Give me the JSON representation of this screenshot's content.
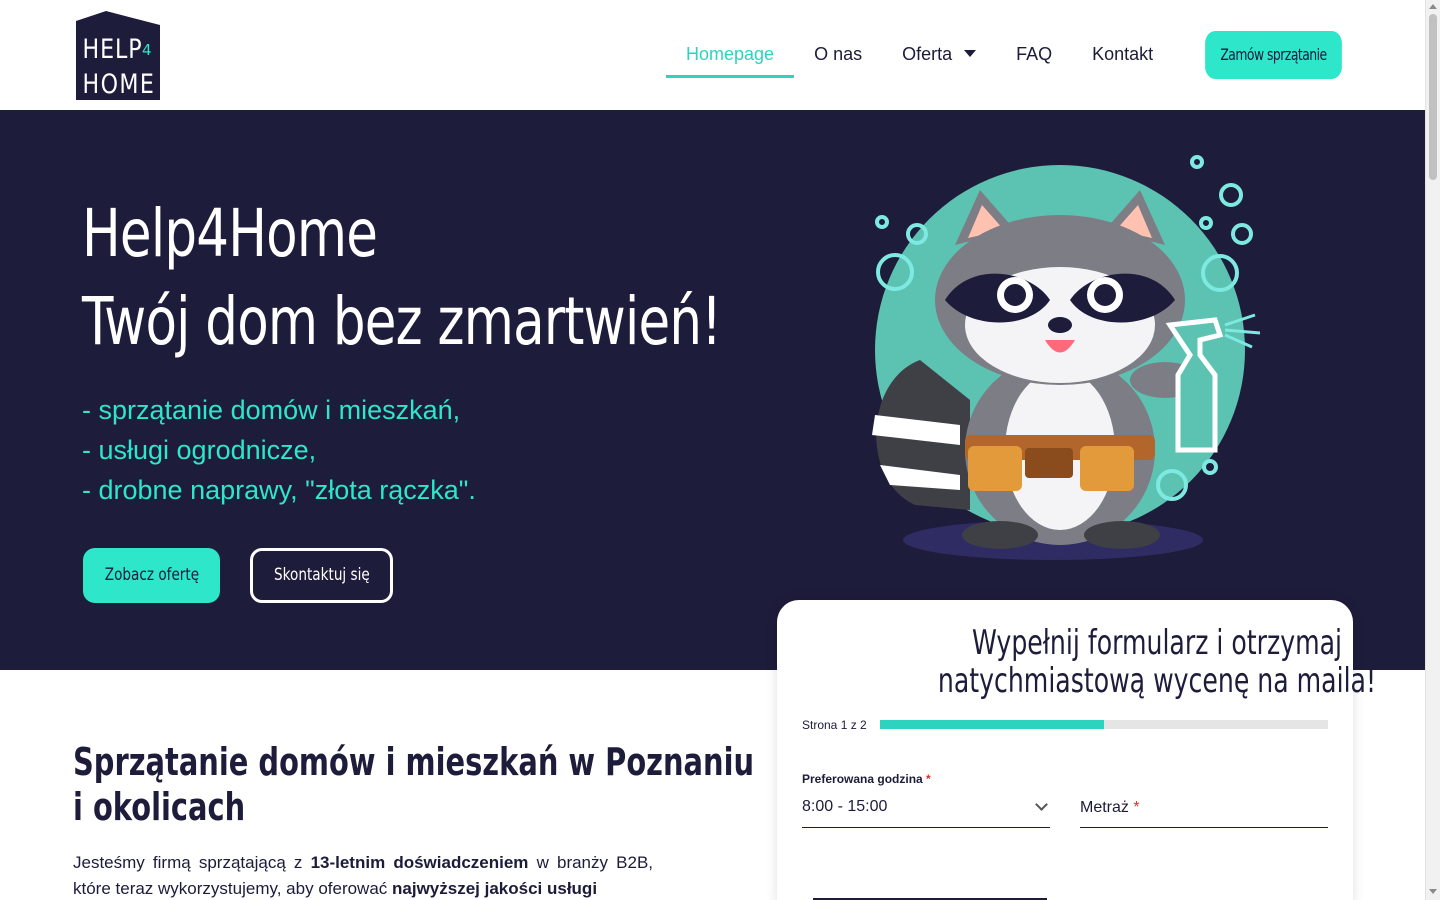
{
  "brand": {
    "logo_line1": "HELP",
    "logo_line2": "HOME",
    "logo_digit": "4"
  },
  "nav": {
    "items": [
      {
        "label": "Homepage",
        "active": true
      },
      {
        "label": "O nas",
        "active": false
      },
      {
        "label": "Oferta",
        "active": false,
        "dropdown": true
      },
      {
        "label": "FAQ",
        "active": false
      },
      {
        "label": "Kontakt",
        "active": false
      }
    ],
    "cta_label": "Zamów sprzątanie"
  },
  "hero": {
    "title_line1": "Help4Home",
    "title_line2": "Twój dom bez zmartwień!",
    "services": [
      "- sprzątanie domów i mieszkań,",
      "- usługi ogrodnicze,",
      "- drobne naprawy, \"złota rączka\"."
    ],
    "primary_button": "Zobacz ofertę",
    "secondary_button": "Skontaktuj się"
  },
  "form": {
    "title": "Wypełnij formularz i otrzymaj natychmiastową wycenę na maila!",
    "page_label": "Strona 1 z 2",
    "progress": 0.5,
    "hour_label": "Preferowana godzina",
    "hour_value": "8:00 - 15:00",
    "area_label": "Metraż",
    "required_mark": "*"
  },
  "intro": {
    "title_line1": "Sprzątanie domów i mieszkań w Poznaniu",
    "title_line2": "i okolicach",
    "text_part1": "Jesteśmy firmą sprzątającą z ",
    "text_bold1": "13-letnim doświadczeniem",
    "text_part2": " w branży B2B, które teraz wykorzystujemy, aby oferować ",
    "text_bold2": "najwyższej jakości usługi"
  },
  "colors": {
    "accent": "#2ee6c9",
    "dark": "#1e1c3b",
    "required": "#d9342b"
  }
}
